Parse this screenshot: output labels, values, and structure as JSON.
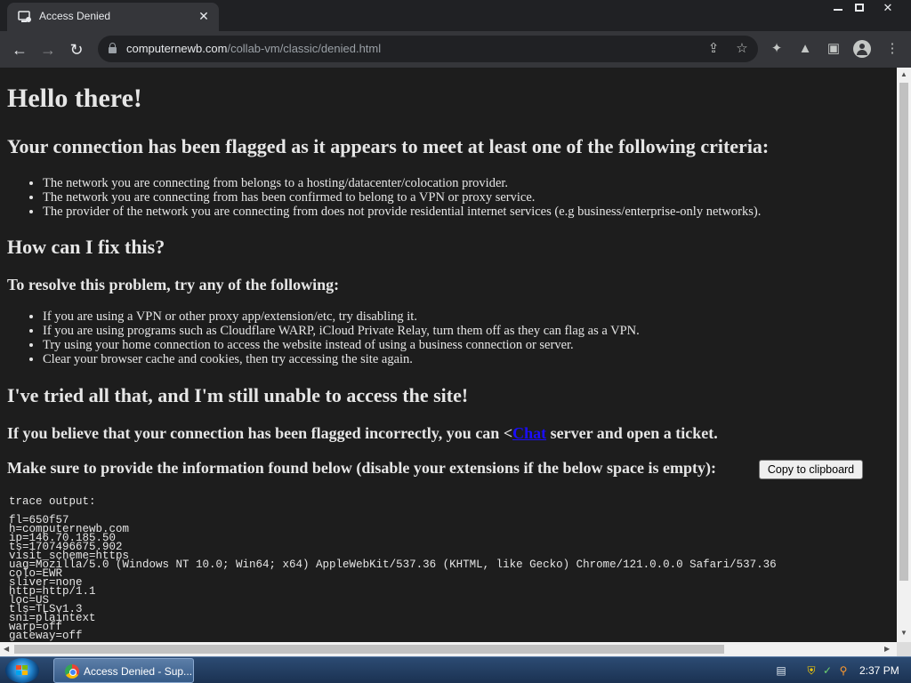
{
  "browser": {
    "tab_title": "Access Denied",
    "url_host": "computernewb.com",
    "url_path": "/collab-vm/classic/denied.html"
  },
  "page": {
    "heading": "Hello there!",
    "flag_heading": "Your connection has been flagged as it appears to meet at least one of the following criteria:",
    "criteria": [
      "The network you are connecting from belongs to a hosting/datacenter/colocation provider.",
      "The network you are connecting from has been confirmed to belong to a VPN or proxy service.",
      "The provider of the network you are connecting from does not provide residential internet services (e.g business/enterprise-only networks)."
    ],
    "fix_heading": "How can I fix this?",
    "resolve_heading": "To resolve this problem, try any of the following:",
    "fixes": [
      "If you are using a VPN or other proxy app/extension/etc, try disabling it.",
      "If you are using programs such as Cloudflare WARP, iCloud Private Relay, turn them off as they can flag as a VPN.",
      "Try using your home connection to access the website instead of using a business connection or server.",
      "Clear your browser cache and cookies, then try accessing the site again."
    ],
    "still_heading": "I've tried all that, and I'm still unable to access the site!",
    "ticket_before": "If you believe that your connection has been flagged incorrectly, you can <",
    "ticket_link": "Chat",
    "ticket_after": " server and open a ticket.",
    "provide_heading": "Make sure to provide the information found below (disable your extensions if the below space is empty):",
    "copy_button": "Copy to clipboard",
    "trace_heading": "trace output:",
    "trace_lines": [
      "fl=650f57",
      "h=computernewb.com",
      "ip=146.70.185.50",
      "ts=1707496675.902",
      "visit_scheme=https",
      "uag=Mozilla/5.0 (Windows NT 10.0; Win64; x64) AppleWebKit/537.36 (KHTML, like Gecko) Chrome/121.0.0.0 Safari/537.36",
      "colo=EWR",
      "sliver=none",
      "http=http/1.1",
      "loc=US",
      "tls=TLSv1.3",
      "sni=plaintext",
      "warp=off",
      "gateway=off"
    ]
  },
  "taskbar": {
    "task_label": "Access Denied - Sup...",
    "clock": "2:37 PM"
  },
  "colors": {
    "page_bg": "#1d1d1d",
    "link": "#1a0dff",
    "chrome_dark": "#202124",
    "chrome_toolbar": "#35363a"
  }
}
